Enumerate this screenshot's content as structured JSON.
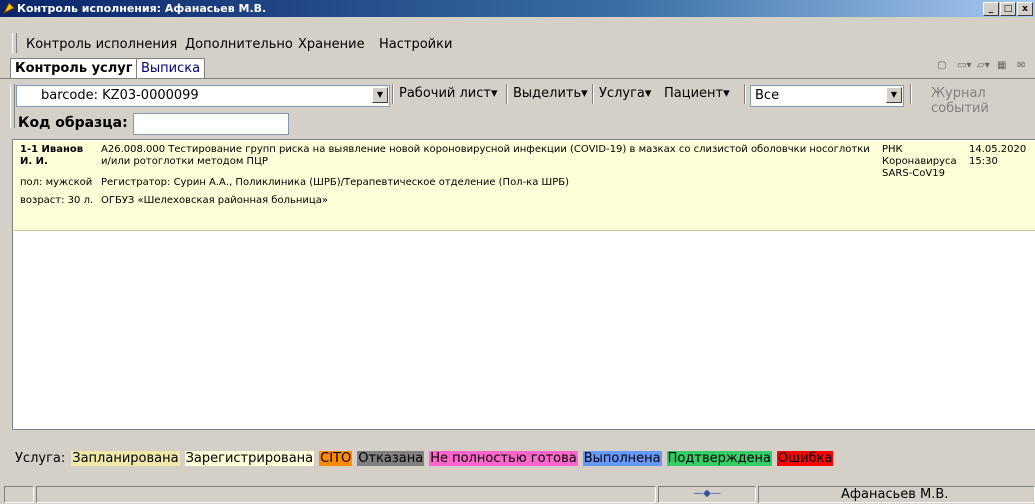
{
  "window": {
    "title": "Контроль исполнения: Афанасьев М.В."
  },
  "menu": [
    "Контроль исполнения",
    "Дополнительно",
    "Хранение",
    "Настройки"
  ],
  "tabs": [
    {
      "label": "Контроль услуг"
    },
    {
      "label": "Выписка"
    }
  ],
  "toolbar": {
    "barcode_value": "barcode: KZ03-0000099",
    "worksheet_label": "Рабочий лист",
    "select_label": "Выделить",
    "service_label": "Услуга",
    "patient_label": "Пациент",
    "filter_value": "Все",
    "events_label": "Журнал событий"
  },
  "sample": {
    "label": "Код образца:",
    "value": ""
  },
  "record": {
    "id_name": "1-1 Иванов",
    "initials": "И. И.",
    "sex": "пол: мужской",
    "age": "возраст: 30 л.",
    "service_line1": "А26.008.000 Тестирование групп риска на выявление новой короновирусной инфекции (COVID-19) в мазках со слизистой оболовчки носоглотки",
    "service_line2": "и/или ротоглотки методом ПЦР",
    "registrar": "Регистратор: Сурин А.А., Поликлиника (ШРБ)/Терапевтическое отделение (Пол-ка ШРБ)",
    "org": "ОГБУЗ «Шелеховская районная больница»",
    "material1": "РНК",
    "material2": "Коронавируса",
    "material3": "SARS-CoV19",
    "date": "14.05.2020",
    "time": "15:30"
  },
  "legend": {
    "label": "Услуга:",
    "items": [
      {
        "text": "Запланирована",
        "color": "#f0e8a8"
      },
      {
        "text": "Зарегистрирована",
        "color": "#fefed8"
      },
      {
        "text": "CITO",
        "color": "#ff8c00"
      },
      {
        "text": "Отказана",
        "color": "#808080"
      },
      {
        "text": "Не полностью готова",
        "color": "#ff66cc"
      },
      {
        "text": "Выполнена",
        "color": "#6699ff"
      },
      {
        "text": "Подтверждена",
        "color": "#33cc66"
      },
      {
        "text": "Ошибка",
        "color": "#ff0000"
      }
    ]
  },
  "status": {
    "user": "Афанасьев М.В."
  }
}
